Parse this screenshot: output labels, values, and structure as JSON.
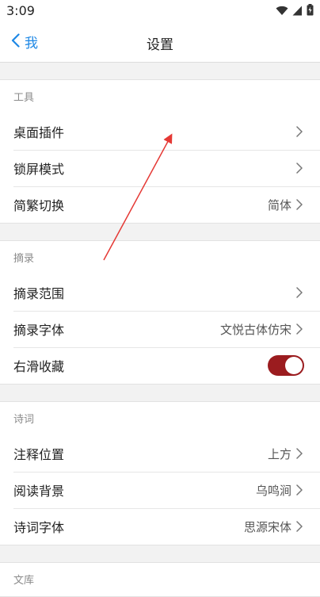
{
  "status_bar": {
    "time": "3:09",
    "icons": [
      "wifi-icon",
      "signal-icon",
      "battery-icon"
    ]
  },
  "header": {
    "back_label": "我",
    "title": "设置"
  },
  "sections": [
    {
      "title": "工具",
      "rows": [
        {
          "label": "桌面插件",
          "value": "",
          "control": "chevron"
        },
        {
          "label": "锁屏模式",
          "value": "",
          "control": "chevron"
        },
        {
          "label": "简繁切换",
          "value": "简体",
          "control": "chevron"
        }
      ]
    },
    {
      "title": "摘录",
      "rows": [
        {
          "label": "摘录范围",
          "value": "",
          "control": "chevron"
        },
        {
          "label": "摘录字体",
          "value": "文悦古体仿宋",
          "control": "chevron"
        },
        {
          "label": "右滑收藏",
          "value": "",
          "control": "toggle",
          "toggle_on": true
        }
      ]
    },
    {
      "title": "诗词",
      "rows": [
        {
          "label": "注释位置",
          "value": "上方",
          "control": "chevron"
        },
        {
          "label": "阅读背景",
          "value": "乌鸣涧",
          "control": "chevron"
        },
        {
          "label": "诗词字体",
          "value": "思源宋体",
          "control": "chevron"
        }
      ]
    },
    {
      "title": "文库",
      "rows": []
    }
  ],
  "colors": {
    "accent": "#1e88e5",
    "toggle_on": "#9b1c1f",
    "annotation_arrow": "#e53935"
  }
}
